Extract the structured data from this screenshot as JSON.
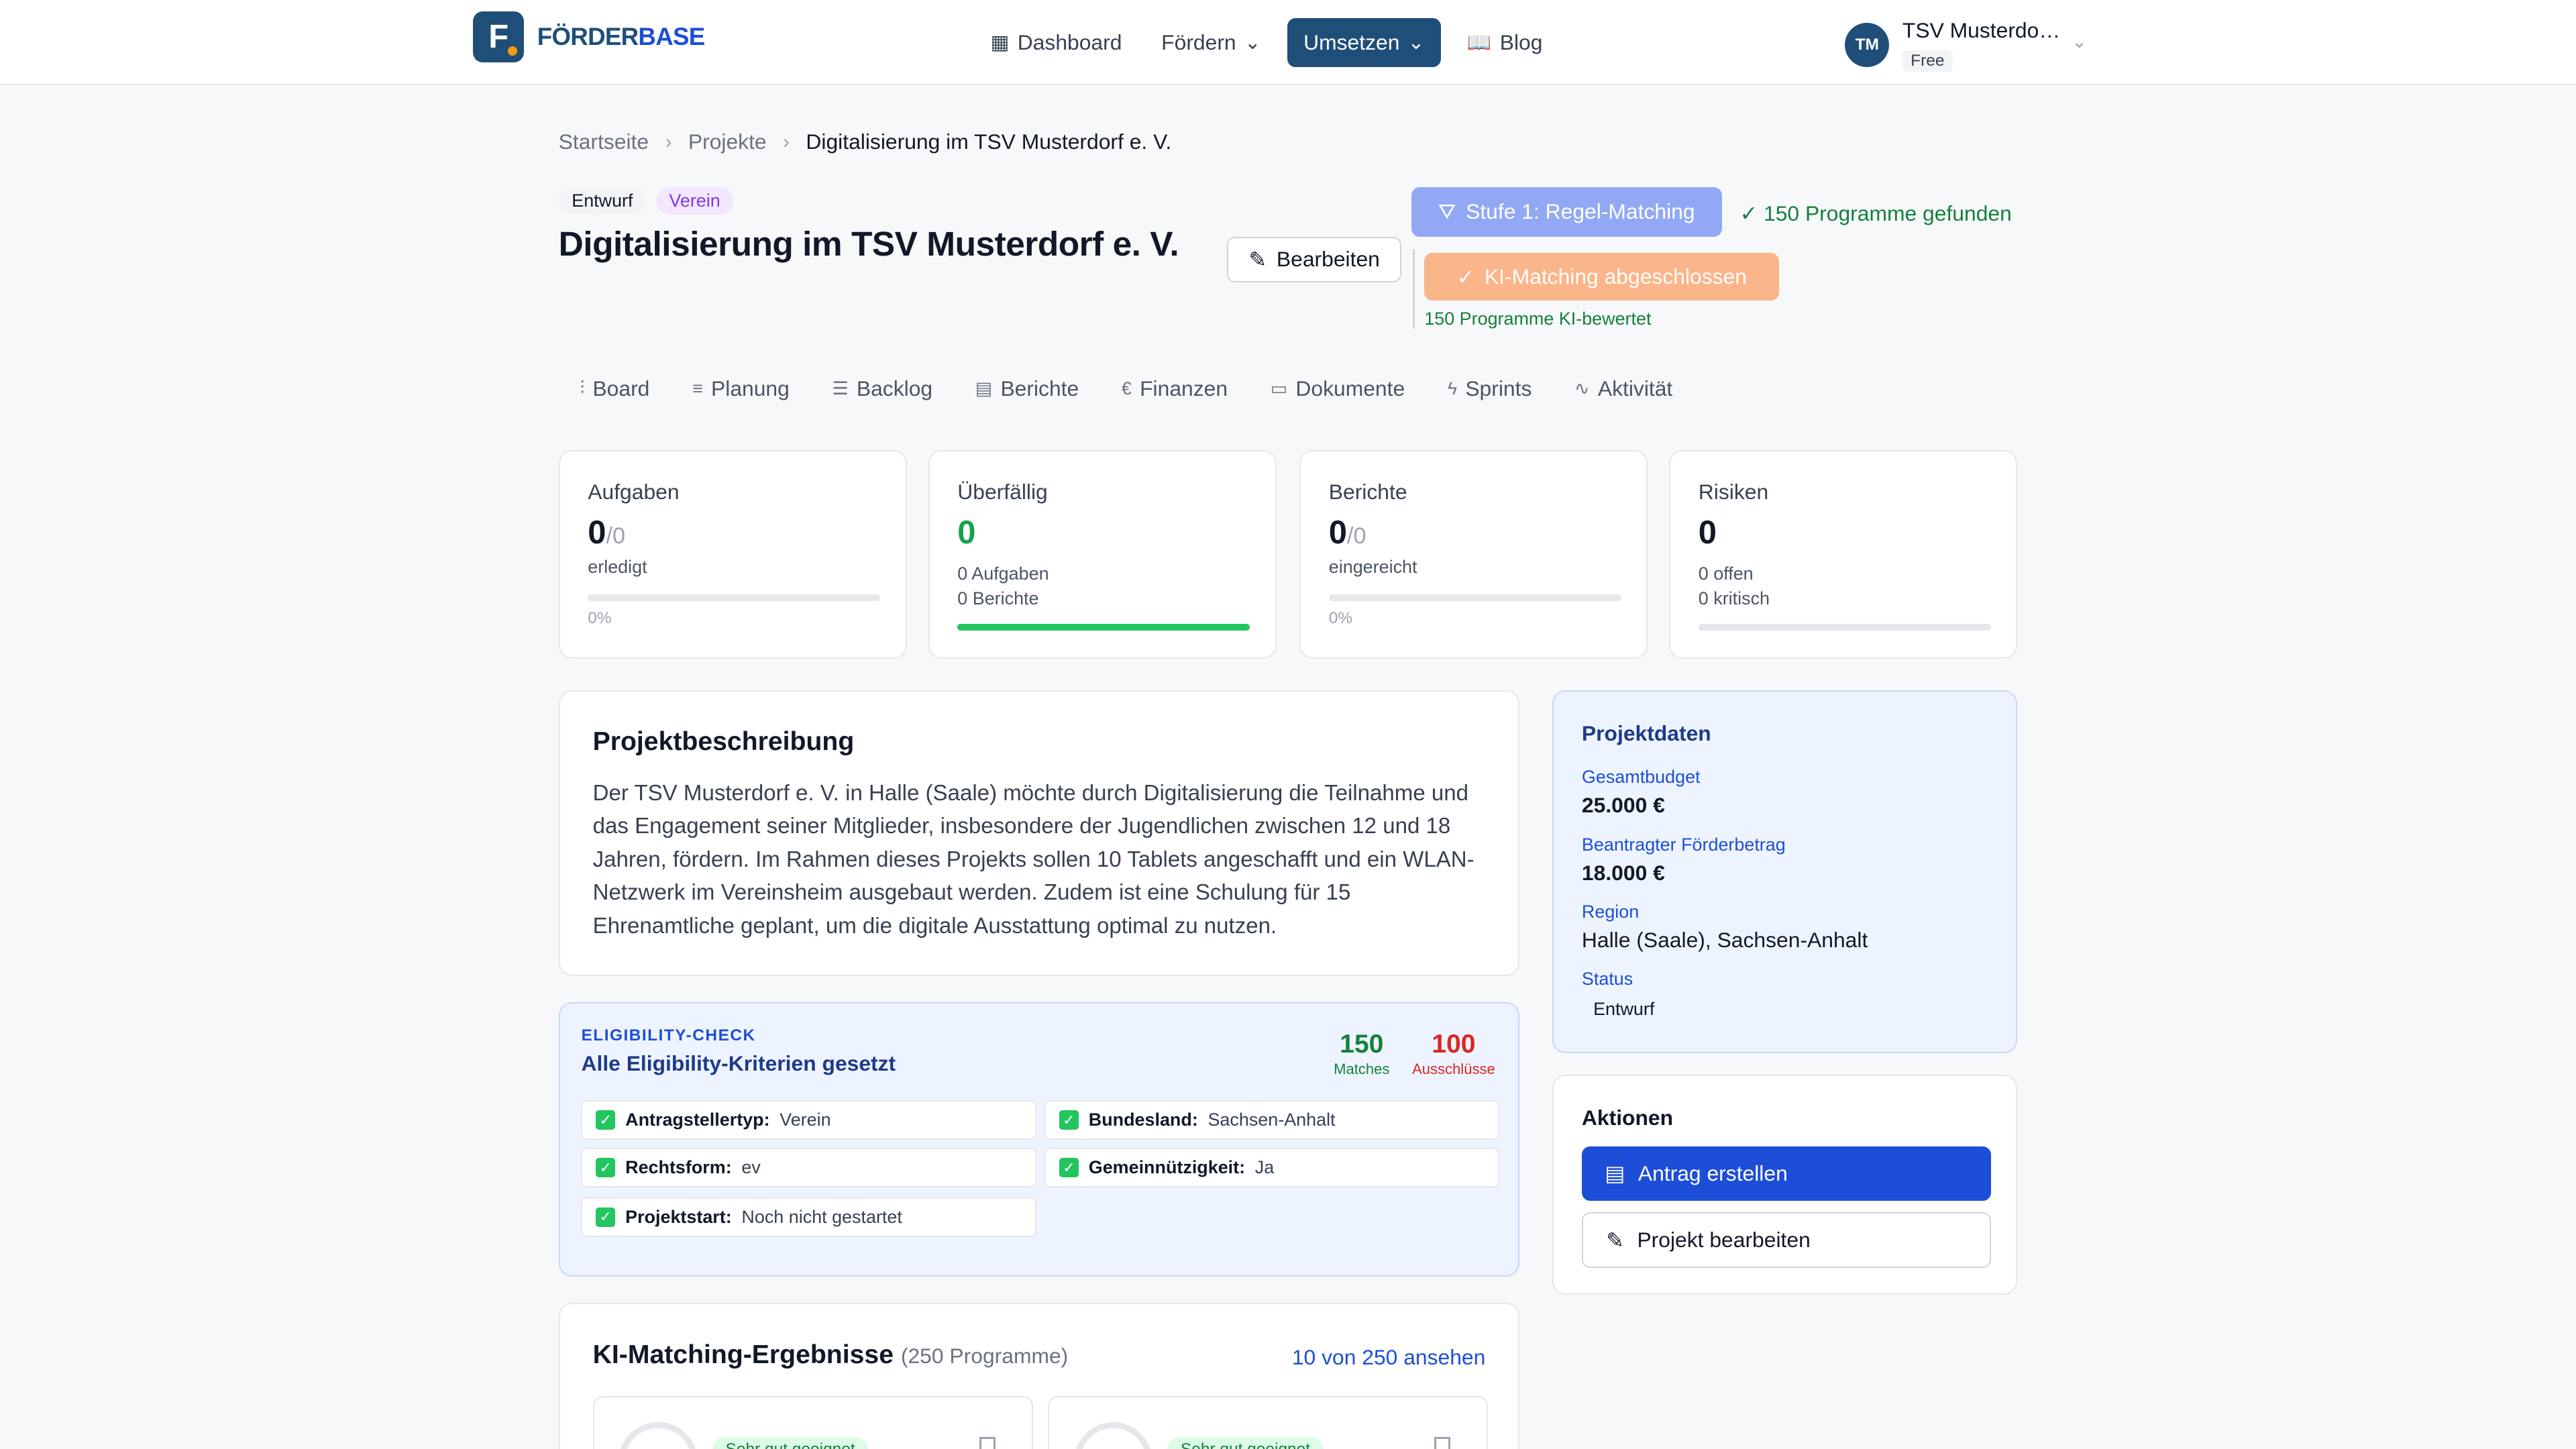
{
  "header": {
    "logo_letter": "F",
    "logo_text_a": "FÖRDER",
    "logo_text_b": "BASE",
    "nav": [
      {
        "label": "Dashboard"
      },
      {
        "label": "Fördern"
      },
      {
        "label": "Umsetzen"
      },
      {
        "label": "Blog"
      }
    ],
    "user": {
      "initials": "TM",
      "name": "TSV Musterdorf e. V.",
      "plan": "Free"
    }
  },
  "breadcrumb": [
    "Startseite",
    "Projekte",
    "Digitalisierung im TSV Musterdorf e. V."
  ],
  "project": {
    "status_badge": "Entwurf",
    "type_badge": "Verein",
    "title": "Digitalisierung im TSV Musterdorf e. V.",
    "edit_label": "Bearbeiten"
  },
  "matching": {
    "stage1_label": "Stufe 1: Regel-Matching",
    "stage1_status": "150 Programme gefunden",
    "stage2_label": "KI-Matching abgeschlossen",
    "stage2_status": "150 Programme KI-bewertet"
  },
  "tabs": [
    "Board",
    "Planung",
    "Backlog",
    "Berichte",
    "Finanzen",
    "Dokumente",
    "Sprints",
    "Aktivität"
  ],
  "stats": {
    "tasks": {
      "label": "Aufgaben",
      "value": "0",
      "den": "/0",
      "sub": "erledigt",
      "pct": "0%",
      "progress": 0
    },
    "overdue": {
      "label": "Überfällig",
      "value": "0",
      "sub1": "0 Aufgaben",
      "sub2": "0 Berichte",
      "progress": 100
    },
    "reports": {
      "label": "Berichte",
      "value": "0",
      "den": "/0",
      "sub": "eingereicht",
      "pct": "0%",
      "progress": 0
    },
    "risks": {
      "label": "Risiken",
      "value": "0",
      "sub1": "0 offen",
      "sub2": "0 kritisch",
      "progress": 0
    }
  },
  "description": {
    "title": "Projektbeschreibung",
    "text": "Der TSV Musterdorf e. V. in Halle (Saale) möchte durch Digitalisierung die Teilnahme und das Engagement seiner Mitglieder, insbesondere der Jugendlichen zwischen 12 und 18 Jahren, fördern. Im Rahmen dieses Projekts sollen 10 Tablets angeschafft und ein WLAN-Netzwerk im Vereinsheim ausgebaut werden. Zudem ist eine Schulung für 15 Ehrenamtliche geplant, um die digitale Ausstattung optimal zu nutzen."
  },
  "eligibility": {
    "kicker": "ELIGIBILITY-CHECK",
    "title": "Alle Eligibility-Kriterien gesetzt",
    "matches": "150",
    "matches_label": "Matches",
    "exclusions": "100",
    "exclusions_label": "Ausschlüsse",
    "criteria": [
      {
        "key": "Antragstellertyp:",
        "value": "Verein"
      },
      {
        "key": "Bundesland:",
        "value": "Sachsen-Anhalt"
      },
      {
        "key": "Rechtsform:",
        "value": "ev"
      },
      {
        "key": "Gemeinnützigkeit:",
        "value": "Ja"
      },
      {
        "key": "Projektstart:",
        "value": "Noch nicht gestartet"
      }
    ]
  },
  "ki_results": {
    "title": "KI-Matching-Ergebnisse",
    "count": "(250 Programme)",
    "link": "10 von 250 ansehen",
    "pill": "Sehr gut geeignet"
  },
  "project_data": {
    "title": "Projektdaten",
    "budget_label": "Gesamtbudget",
    "budget": "25.000 €",
    "requested_label": "Beantragter Förderbetrag",
    "requested": "18.000 €",
    "region_label": "Region",
    "region": "Halle (Saale), Sachsen-Anhalt",
    "status_label": "Status",
    "status": "Entwurf"
  },
  "actions": {
    "title": "Aktionen",
    "primary": "Antrag erstellen",
    "secondary": "Projekt bearbeiten"
  },
  "colors": {
    "brand": "#1f4e79",
    "primary": "#1d4ed8",
    "success": "#16a34a",
    "danger": "#dc2626"
  }
}
